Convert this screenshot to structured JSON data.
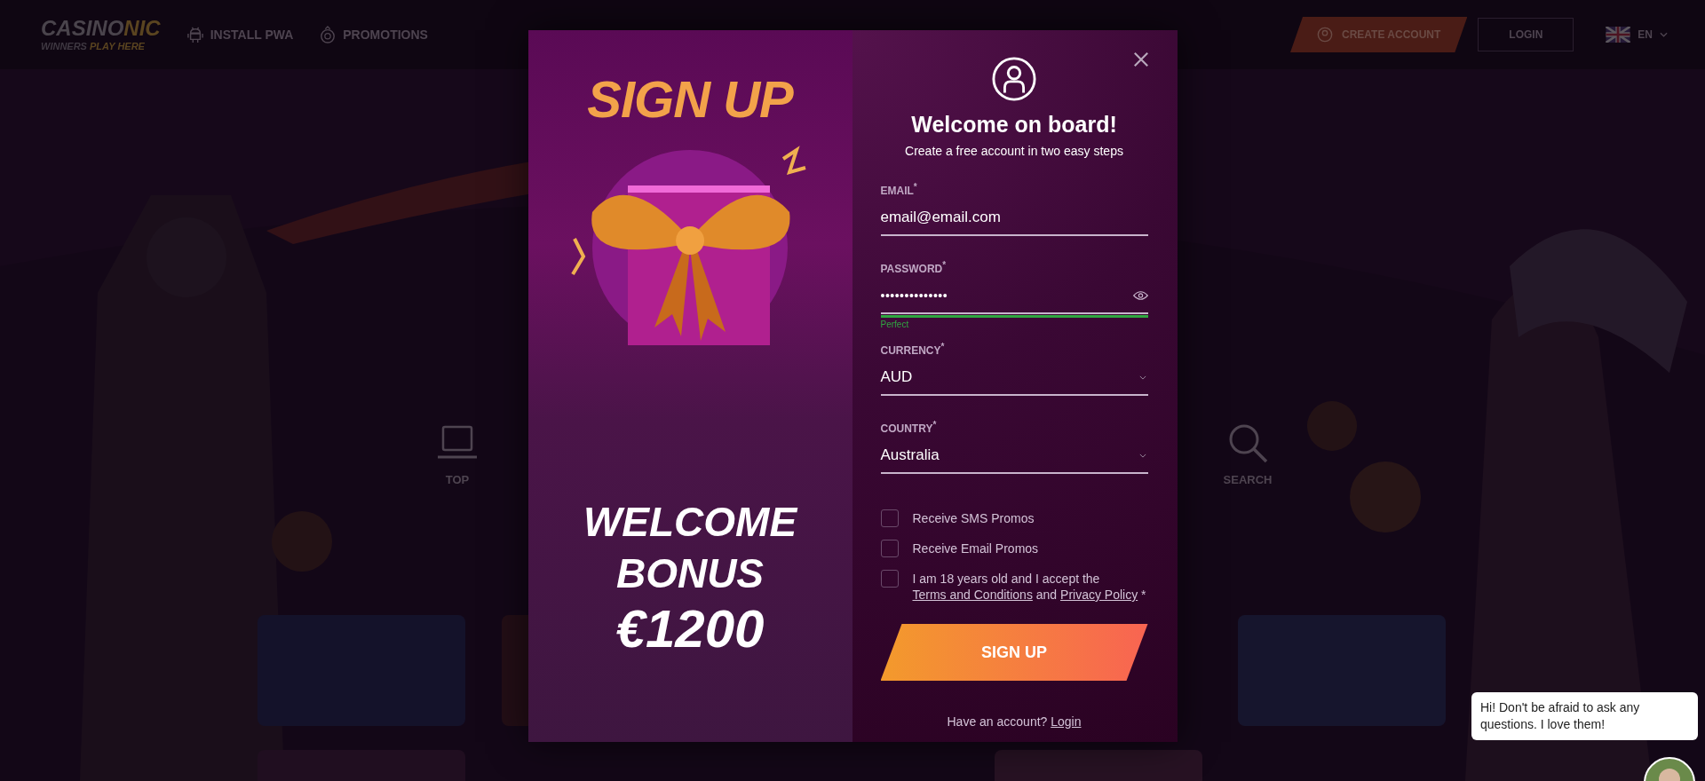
{
  "header": {
    "logo": {
      "parts": [
        "CASINO",
        "NIC"
      ],
      "tagline": [
        "WINNERS",
        "PLAY HERE"
      ]
    },
    "nav": [
      {
        "label": "INSTALL PWA"
      },
      {
        "label": "PROMOTIONS"
      }
    ],
    "create_account": "CREATE ACCOUNT",
    "login": "LOGIN",
    "language": "EN"
  },
  "categories": [
    {
      "label": "TOP"
    },
    {
      "label": "SEARCH"
    }
  ],
  "modal": {
    "promo": {
      "title": "SIGN UP",
      "bonus": [
        "WELCOME",
        "BONUS",
        "€1200"
      ]
    },
    "title": "Welcome on board!",
    "subtitle": "Create a free account in two easy steps",
    "fields": [
      {
        "kind": "text",
        "label": "EMAIL$^{*}$",
        "value": "email@email.com"
      },
      {
        "kind": "password",
        "label": "PASSWORD$^{*}$",
        "value": "••••••••••••••",
        "strength": {
          "label": "Perfect",
          "level": 1
        }
      },
      {
        "kind": "select",
        "label": "CURRENCY$^{*}$",
        "value": "AUD"
      },
      {
        "kind": "select",
        "label": "COUNTRY$^{*}$",
        "value": "Australia"
      }
    ],
    "checkboxes": [
      {
        "checked": false,
        "parts": [
          {
            "kind": "text",
            "text": "Receive SMS Promos"
          }
        ]
      },
      {
        "checked": false,
        "parts": [
          {
            "kind": "text",
            "text": "Receive Email Promos"
          }
        ]
      },
      {
        "checked": false,
        "parts": [
          {
            "kind": "text",
            "text": "I am 18 years old and I accept the"
          },
          {
            "kind": "link",
            "text": "Terms and Conditions"
          },
          {
            "kind": "text",
            "text": "and"
          },
          {
            "kind": "link",
            "text": "Privacy Policy"
          },
          {
            "kind": "text",
            "text": "*"
          }
        ]
      }
    ],
    "submit": "SIGN UP",
    "footer": {
      "text": "Have an account?",
      "link": "Login"
    }
  },
  "chat": {
    "message": "Hi! Don't be afraid to ask any questions. I love them!"
  }
}
